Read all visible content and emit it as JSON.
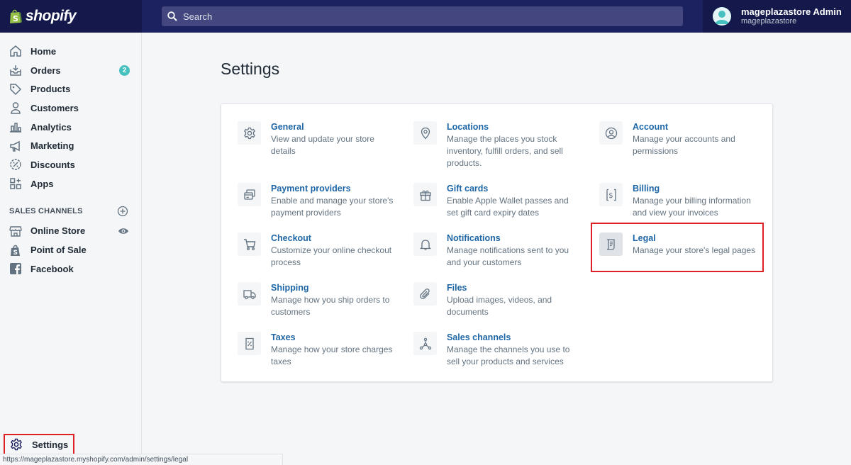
{
  "brand": {
    "name": "shopify"
  },
  "search": {
    "placeholder": "Search"
  },
  "user": {
    "name": "mageplazastore Admin",
    "store": "mageplazastore"
  },
  "sidebar": {
    "items": [
      {
        "label": "Home",
        "icon": "home-icon"
      },
      {
        "label": "Orders",
        "icon": "orders-icon",
        "badge": "2"
      },
      {
        "label": "Products",
        "icon": "tag-icon"
      },
      {
        "label": "Customers",
        "icon": "person-icon"
      },
      {
        "label": "Analytics",
        "icon": "bar-chart-icon"
      },
      {
        "label": "Marketing",
        "icon": "megaphone-icon"
      },
      {
        "label": "Discounts",
        "icon": "discount-icon"
      },
      {
        "label": "Apps",
        "icon": "apps-icon"
      }
    ],
    "sales_channels_heading": "SALES CHANNELS",
    "channels": [
      {
        "label": "Online Store",
        "icon": "store-icon"
      },
      {
        "label": "Point of Sale",
        "icon": "shopping-bag-icon"
      },
      {
        "label": "Facebook",
        "icon": "facebook-icon"
      }
    ],
    "settings_label": "Settings"
  },
  "status_url": "https://mageplazastore.myshopify.com/admin/settings/legal",
  "main": {
    "title": "Settings",
    "settings": [
      {
        "title": "General",
        "desc": "View and update your store details"
      },
      {
        "title": "Locations",
        "desc": "Manage the places you stock inventory, fulfill orders, and sell products."
      },
      {
        "title": "Account",
        "desc": "Manage your accounts and permissions"
      },
      {
        "title": "Payment providers",
        "desc": "Enable and manage your store's payment providers"
      },
      {
        "title": "Gift cards",
        "desc": "Enable Apple Wallet passes and set gift card expiry dates"
      },
      {
        "title": "Billing",
        "desc": "Manage your billing information and view your invoices"
      },
      {
        "title": "Checkout",
        "desc": "Customize your online checkout process"
      },
      {
        "title": "Notifications",
        "desc": "Manage notifications sent to you and your customers"
      },
      {
        "title": "Legal",
        "desc": "Manage your store's legal pages"
      },
      {
        "title": "Shipping",
        "desc": "Manage how you ship orders to customers"
      },
      {
        "title": "Files",
        "desc": "Upload images, videos, and documents"
      },
      {
        "title": "Taxes",
        "desc": "Manage how your store charges taxes"
      },
      {
        "title": "Sales channels",
        "desc": "Manage the channels you use to sell your products and services"
      }
    ]
  },
  "colors": {
    "topbar": "#1c2260",
    "link": "#1e66a6",
    "highlight": "#de1f26",
    "badge": "#47c1bf"
  }
}
